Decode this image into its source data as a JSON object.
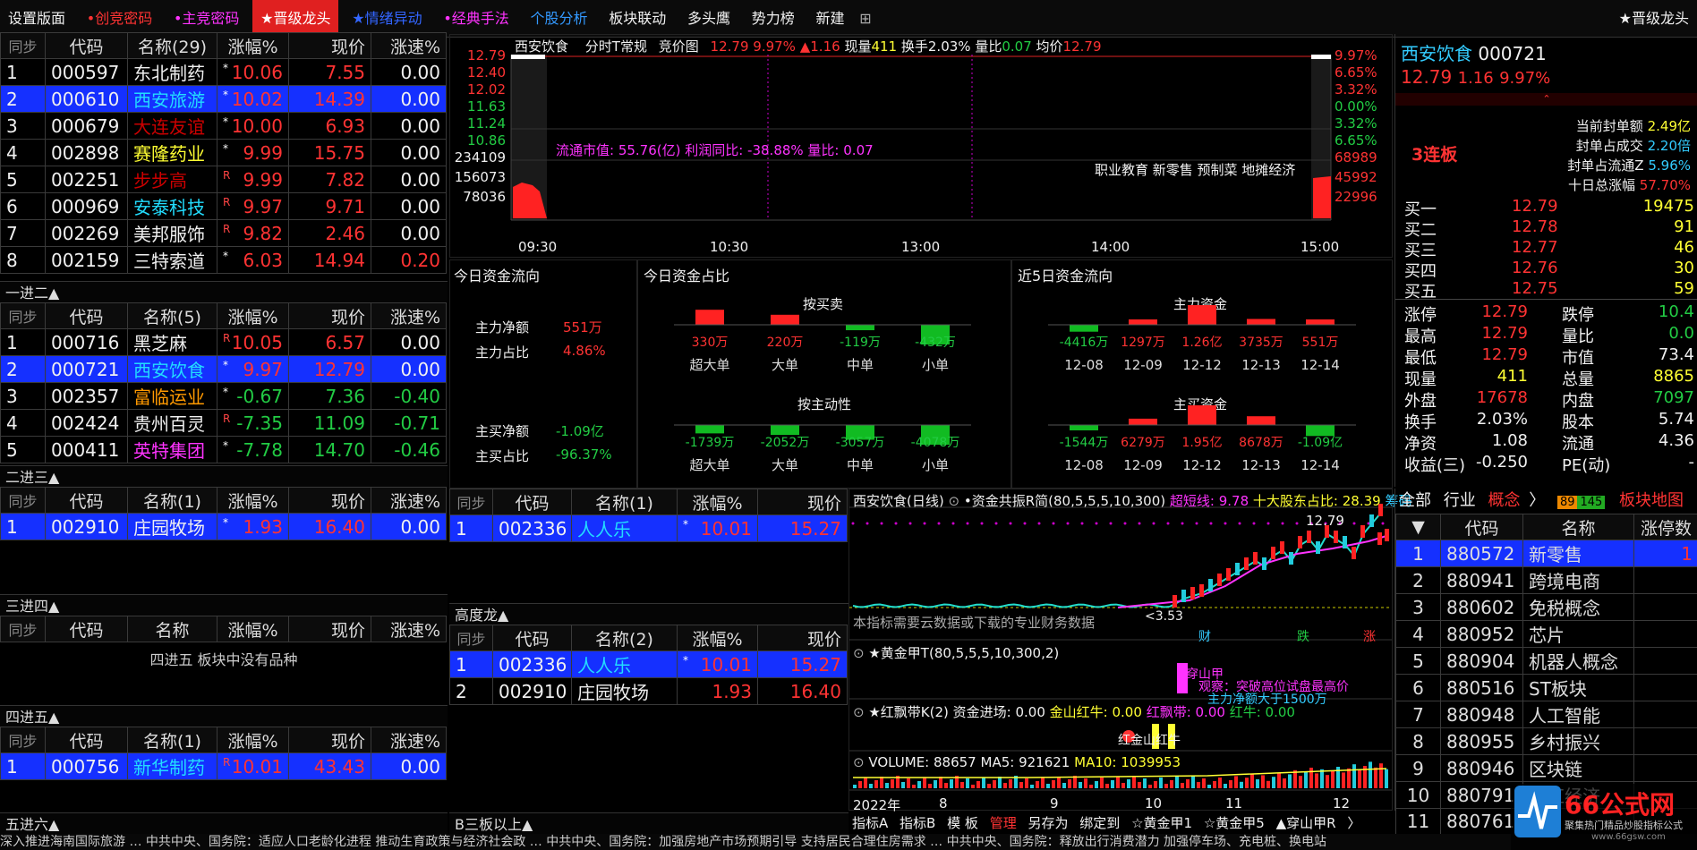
{
  "topbar": {
    "items": [
      "设置版面",
      "•创竞密码",
      "•主竞密码",
      "★晋级龙头",
      "★情绪异动",
      "•经典手法",
      "个股分析",
      "板块联动",
      "多头鹰",
      "势力榜",
      "新建"
    ],
    "right_label": "★晋级龙头"
  },
  "headers": {
    "sync": "同步",
    "code": "代码",
    "change": "涨幅%",
    "price": "现价",
    "speed": "涨速%"
  },
  "t1": {
    "name_header": "名称(29)",
    "rows": [
      {
        "no": "1",
        "code": "000597",
        "name": "东北制药",
        "mark": "*",
        "chg": "10.06",
        "price": "7.55",
        "speed": "0.00"
      },
      {
        "no": "2",
        "code": "000610",
        "name": "西安旅游",
        "mark": "*",
        "chg": "10.02",
        "price": "14.39",
        "speed": "0.00"
      },
      {
        "no": "3",
        "code": "000679",
        "name": "大连友谊",
        "mark": "*",
        "chg": "10.00",
        "price": "6.93",
        "speed": "0.00"
      },
      {
        "no": "4",
        "code": "002898",
        "name": "赛隆药业",
        "mark": "*",
        "chg": "9.99",
        "price": "15.75",
        "speed": "0.00"
      },
      {
        "no": "5",
        "code": "002251",
        "name": "步步高",
        "mark": "R",
        "chg": "9.99",
        "price": "7.82",
        "speed": "0.00"
      },
      {
        "no": "6",
        "code": "000969",
        "name": "安泰科技",
        "mark": "R",
        "chg": "9.97",
        "price": "9.71",
        "speed": "0.00"
      },
      {
        "no": "7",
        "code": "002269",
        "name": "美邦服饰",
        "mark": "R",
        "chg": "9.82",
        "price": "2.46",
        "speed": "0.00"
      },
      {
        "no": "8",
        "code": "002159",
        "name": "三特索道",
        "mark": "*",
        "chg": "6.03",
        "price": "14.94",
        "speed": "0.20"
      }
    ]
  },
  "s1": "一进二▲",
  "t2": {
    "name_header": "名称(5)",
    "rows": [
      {
        "no": "1",
        "code": "000716",
        "name": "黑芝麻",
        "mark": "R",
        "chg": "10.05",
        "price": "6.57",
        "speed": "0.00"
      },
      {
        "no": "2",
        "code": "000721",
        "name": "西安饮食",
        "mark": "*",
        "chg": "9.97",
        "price": "12.79",
        "speed": "0.00"
      },
      {
        "no": "3",
        "code": "002357",
        "name": "富临运业",
        "mark": "*",
        "chg": "-0.67",
        "price": "7.36",
        "speed": "-0.40"
      },
      {
        "no": "4",
        "code": "002424",
        "name": "贵州百灵",
        "mark": "R",
        "chg": "-7.35",
        "price": "11.09",
        "speed": "-0.71"
      },
      {
        "no": "5",
        "code": "000411",
        "name": "英特集团",
        "mark": "*",
        "chg": "-7.78",
        "price": "14.70",
        "speed": "-0.46"
      }
    ]
  },
  "s2": "二进三▲",
  "t3": {
    "name_header": "名称(1)",
    "rows": [
      {
        "no": "1",
        "code": "002910",
        "name": "庄园牧场",
        "mark": "*",
        "chg": "1.93",
        "price": "16.40",
        "speed": "0.00"
      }
    ]
  },
  "s3": "三进四▲",
  "t4": {
    "name_header": "名称",
    "empty": "四进五 板块中没有品种"
  },
  "s4": "四进五▲",
  "t5": {
    "name_header": "名称(1)",
    "rows": [
      {
        "no": "1",
        "code": "000756",
        "name": "新华制药",
        "mark": "R",
        "chg": "10.01",
        "price": "43.43",
        "speed": "0.00"
      }
    ]
  },
  "s5": "五进六▲",
  "mid_t1": {
    "name_header": "名称(1)",
    "rows": [
      {
        "no": "1",
        "code": "002336",
        "name": "人人乐",
        "mark": "*",
        "chg": "10.01",
        "price": "15.27"
      }
    ]
  },
  "s_gdl": "高度龙▲",
  "mid_t2": {
    "name_header": "名称(2)",
    "rows": [
      {
        "no": "1",
        "code": "002336",
        "name": "人人乐",
        "mark": "*",
        "chg": "10.01",
        "price": "15.27"
      },
      {
        "no": "2",
        "code": "002910",
        "name": "庄园牧场",
        "mark": "",
        "chg": "1.93",
        "price": "16.40"
      }
    ]
  },
  "s_b3": "B三板以上▲",
  "intraday": {
    "stock": "西安饮食",
    "mode": "分时T常规",
    "auction": "竞价图",
    "price": "12.79",
    "pct": "9.97%",
    "chg": "▲1.16",
    "vol_label": "现量",
    "vol": "411",
    "turnover_label": "换手",
    "turnover": "2.03%",
    "vr_label": "量比",
    "vr": "0.07",
    "avg_label": "均价",
    "avg": "12.79",
    "left_prices": [
      "12.79",
      "12.40",
      "12.02",
      "11.63",
      "11.24",
      "10.86"
    ],
    "right_pcts": [
      "9.97%",
      "6.65%",
      "3.32%",
      "0.00%",
      "3.32%",
      "6.65%"
    ],
    "left_vols": [
      "234109",
      "156073",
      "78036"
    ],
    "right_vols": [
      "68989",
      "45992",
      "22996"
    ],
    "times": [
      "09:30",
      "10:30",
      "13:00",
      "14:00",
      "15:00"
    ],
    "info": "流通市值: 55.76(亿)   利润同比: -38.88%   量比: 0.07",
    "concepts": "职业教育 新零售 预制菜 地摊经济"
  },
  "flow": {
    "today_title": "今日资金流向",
    "main_net_label": "主力净额",
    "main_net": "551万",
    "main_ratio_label": "主力占比",
    "main_ratio": "4.86%",
    "buy_net_label": "主买净额",
    "buy_net": "-1.09亿",
    "buy_ratio_label": "主买占比",
    "buy_ratio": "-96.37%",
    "share_title": "今日资金占比",
    "by_trade": "按买卖",
    "by_active": "按主动性",
    "cats": [
      "超大单",
      "大单",
      "中单",
      "小单"
    ],
    "trade_vals": [
      {
        "v": "330万",
        "c": "red"
      },
      {
        "v": "220万",
        "c": "red"
      },
      {
        "v": "-119万",
        "c": "green"
      },
      {
        "v": "-432万",
        "c": "green"
      }
    ],
    "active_vals": [
      {
        "v": "-1739万",
        "c": "green"
      },
      {
        "v": "-2052万",
        "c": "green"
      },
      {
        "v": "-3057万",
        "c": "green"
      },
      {
        "v": "-4078万",
        "c": "green"
      }
    ],
    "five_title": "近5日资金流向",
    "main_fund": "主力资金",
    "main_buy": "主买资金",
    "dates": [
      "12-08",
      "12-09",
      "12-12",
      "12-13",
      "12-14"
    ],
    "five_main": [
      {
        "v": "-4416万",
        "c": "green"
      },
      {
        "v": "1297万",
        "c": "red"
      },
      {
        "v": "1.26亿",
        "c": "red"
      },
      {
        "v": "3735万",
        "c": "red"
      },
      {
        "v": "551万",
        "c": "red"
      }
    ],
    "five_buy": [
      {
        "v": "-1544万",
        "c": "green"
      },
      {
        "v": "6279万",
        "c": "red"
      },
      {
        "v": "1.95亿",
        "c": "red"
      },
      {
        "v": "8678万",
        "c": "red"
      },
      {
        "v": "-1.09亿",
        "c": "green"
      }
    ]
  },
  "kline": {
    "title": "西安饮食(日线)",
    "ind": "•资金共振R简(80,5,5,5,10,300)",
    "super": "超短线: 9.78",
    "top10": "十大股东占比: 28.39",
    "tail": "筹码",
    "price_mark": "12.79",
    "low_mark": "<3.53",
    "note": "本指标需要云数据或下载的专业财务数据",
    "tags": [
      "财",
      "跌",
      "涨"
    ],
    "gold": "★黄金甲T(80,5,5,5,10,300,2)",
    "gold_t1": "穿山甲",
    "gold_t2": "观察：突破高位试盘最高价",
    "gold_t3": "主力净额大于1500万",
    "red": "★红飘带K(2) 资金进场: 0.00",
    "red2": "金山红牛: 0.00",
    "red3": "红飘带: 0.00",
    "red4": "红牛: 0.00",
    "red_t": "红金山红牛",
    "vol": "VOLUME: 88657",
    "ma5": "MA5: 921621",
    "ma10": "MA10: 1039953",
    "months": [
      "2022年",
      "8",
      "9",
      "10",
      "11",
      "12"
    ],
    "tabs": [
      "指标A",
      "指标B",
      "模 板",
      "管理",
      "另存为",
      "绑定到",
      "☆黄金甲1",
      "☆黄金甲5",
      "▲穿山甲R",
      "〉"
    ]
  },
  "quote": {
    "name": "西安饮食",
    "code": "000721",
    "price": "12.79",
    "chg": "1.16",
    "pct": "9.97%",
    "streak": "3连板",
    "seal": [
      {
        "l": "当前封单额",
        "v": "2.49亿"
      },
      {
        "l": "封单占成交",
        "v": "2.20倍"
      },
      {
        "l": "封单占流通Z",
        "v": "5.96%"
      },
      {
        "l": "十日总涨幅",
        "v": "57.70%"
      }
    ],
    "bids": [
      {
        "l": "买一",
        "p": "12.79",
        "v": "19475"
      },
      {
        "l": "买二",
        "p": "12.78",
        "v": "91"
      },
      {
        "l": "买三",
        "p": "12.77",
        "v": "46"
      },
      {
        "l": "买四",
        "p": "12.76",
        "v": "30"
      },
      {
        "l": "买五",
        "p": "12.75",
        "v": "59"
      }
    ],
    "stats": [
      {
        "l": "涨停",
        "v": "12.79",
        "c": "red",
        "l2": "跌停",
        "v2": "10.4",
        "c2": "green"
      },
      {
        "l": "最高",
        "v": "12.79",
        "c": "red",
        "l2": "量比",
        "v2": "0.0",
        "c2": "green"
      },
      {
        "l": "最低",
        "v": "12.79",
        "c": "red",
        "l2": "市值",
        "v2": "73.4",
        "c2": "white"
      },
      {
        "l": "现量",
        "v": "411",
        "c": "yellow",
        "l2": "总量",
        "v2": "8865",
        "c2": "yellow"
      },
      {
        "l": "外盘",
        "v": "17678",
        "c": "red",
        "l2": "内盘",
        "v2": "7097",
        "c2": "green"
      },
      {
        "l": "换手",
        "v": "2.03%",
        "c": "white",
        "l2": "股本",
        "v2": "5.74",
        "c2": "white"
      },
      {
        "l": "净资",
        "v": "1.08",
        "c": "white",
        "l2": "流通",
        "v2": "4.36",
        "c2": "white"
      },
      {
        "l": "收益(三)",
        "v": "-0.250",
        "c": "white",
        "l2": "PE(动)",
        "v2": "-",
        "c2": "white"
      }
    ]
  },
  "sector": {
    "tabs": [
      "全部",
      "行业",
      "概念",
      "〉"
    ],
    "badge1": "89",
    "badge2": "145",
    "map": "板块地图",
    "code_h": "代码",
    "name_h": "名称",
    "chg_h": "涨停数",
    "rows": [
      {
        "no": "1",
        "code": "880572",
        "name": "新零售",
        "v": "1"
      },
      {
        "no": "2",
        "code": "880941",
        "name": "跨境电商",
        "v": ""
      },
      {
        "no": "3",
        "code": "880602",
        "name": "免税概念",
        "v": ""
      },
      {
        "no": "4",
        "code": "880952",
        "name": "芯片",
        "v": ""
      },
      {
        "no": "5",
        "code": "880904",
        "name": "机器人概念",
        "v": ""
      },
      {
        "no": "6",
        "code": "880516",
        "name": "ST板块",
        "v": ""
      },
      {
        "no": "7",
        "code": "880948",
        "name": "人工智能",
        "v": ""
      },
      {
        "no": "8",
        "code": "880955",
        "name": "乡村振兴",
        "v": ""
      },
      {
        "no": "9",
        "code": "880946",
        "name": "区块链",
        "v": ""
      },
      {
        "no": "10",
        "code": "880791",
        "name": "网红经济",
        "v": ""
      },
      {
        "no": "11",
        "code": "880761",
        "name": "",
        "v": ""
      }
    ]
  },
  "news": "深入推进海南国际旅游 … 中共中央、国务院：适应人口老龄化进程 推动生育政策与经济社会政 … 中共中央、国务院：加强房地产市场预期引导 支持居民合理住房需求 … 中共中央、国务院：释放出行消费潜力 加强停车场、充电桩、换电站",
  "watermark": {
    "text": "66公式网",
    "sub": "聚集热门精品炒股指标公式",
    "url": "www.66gsw.com"
  }
}
